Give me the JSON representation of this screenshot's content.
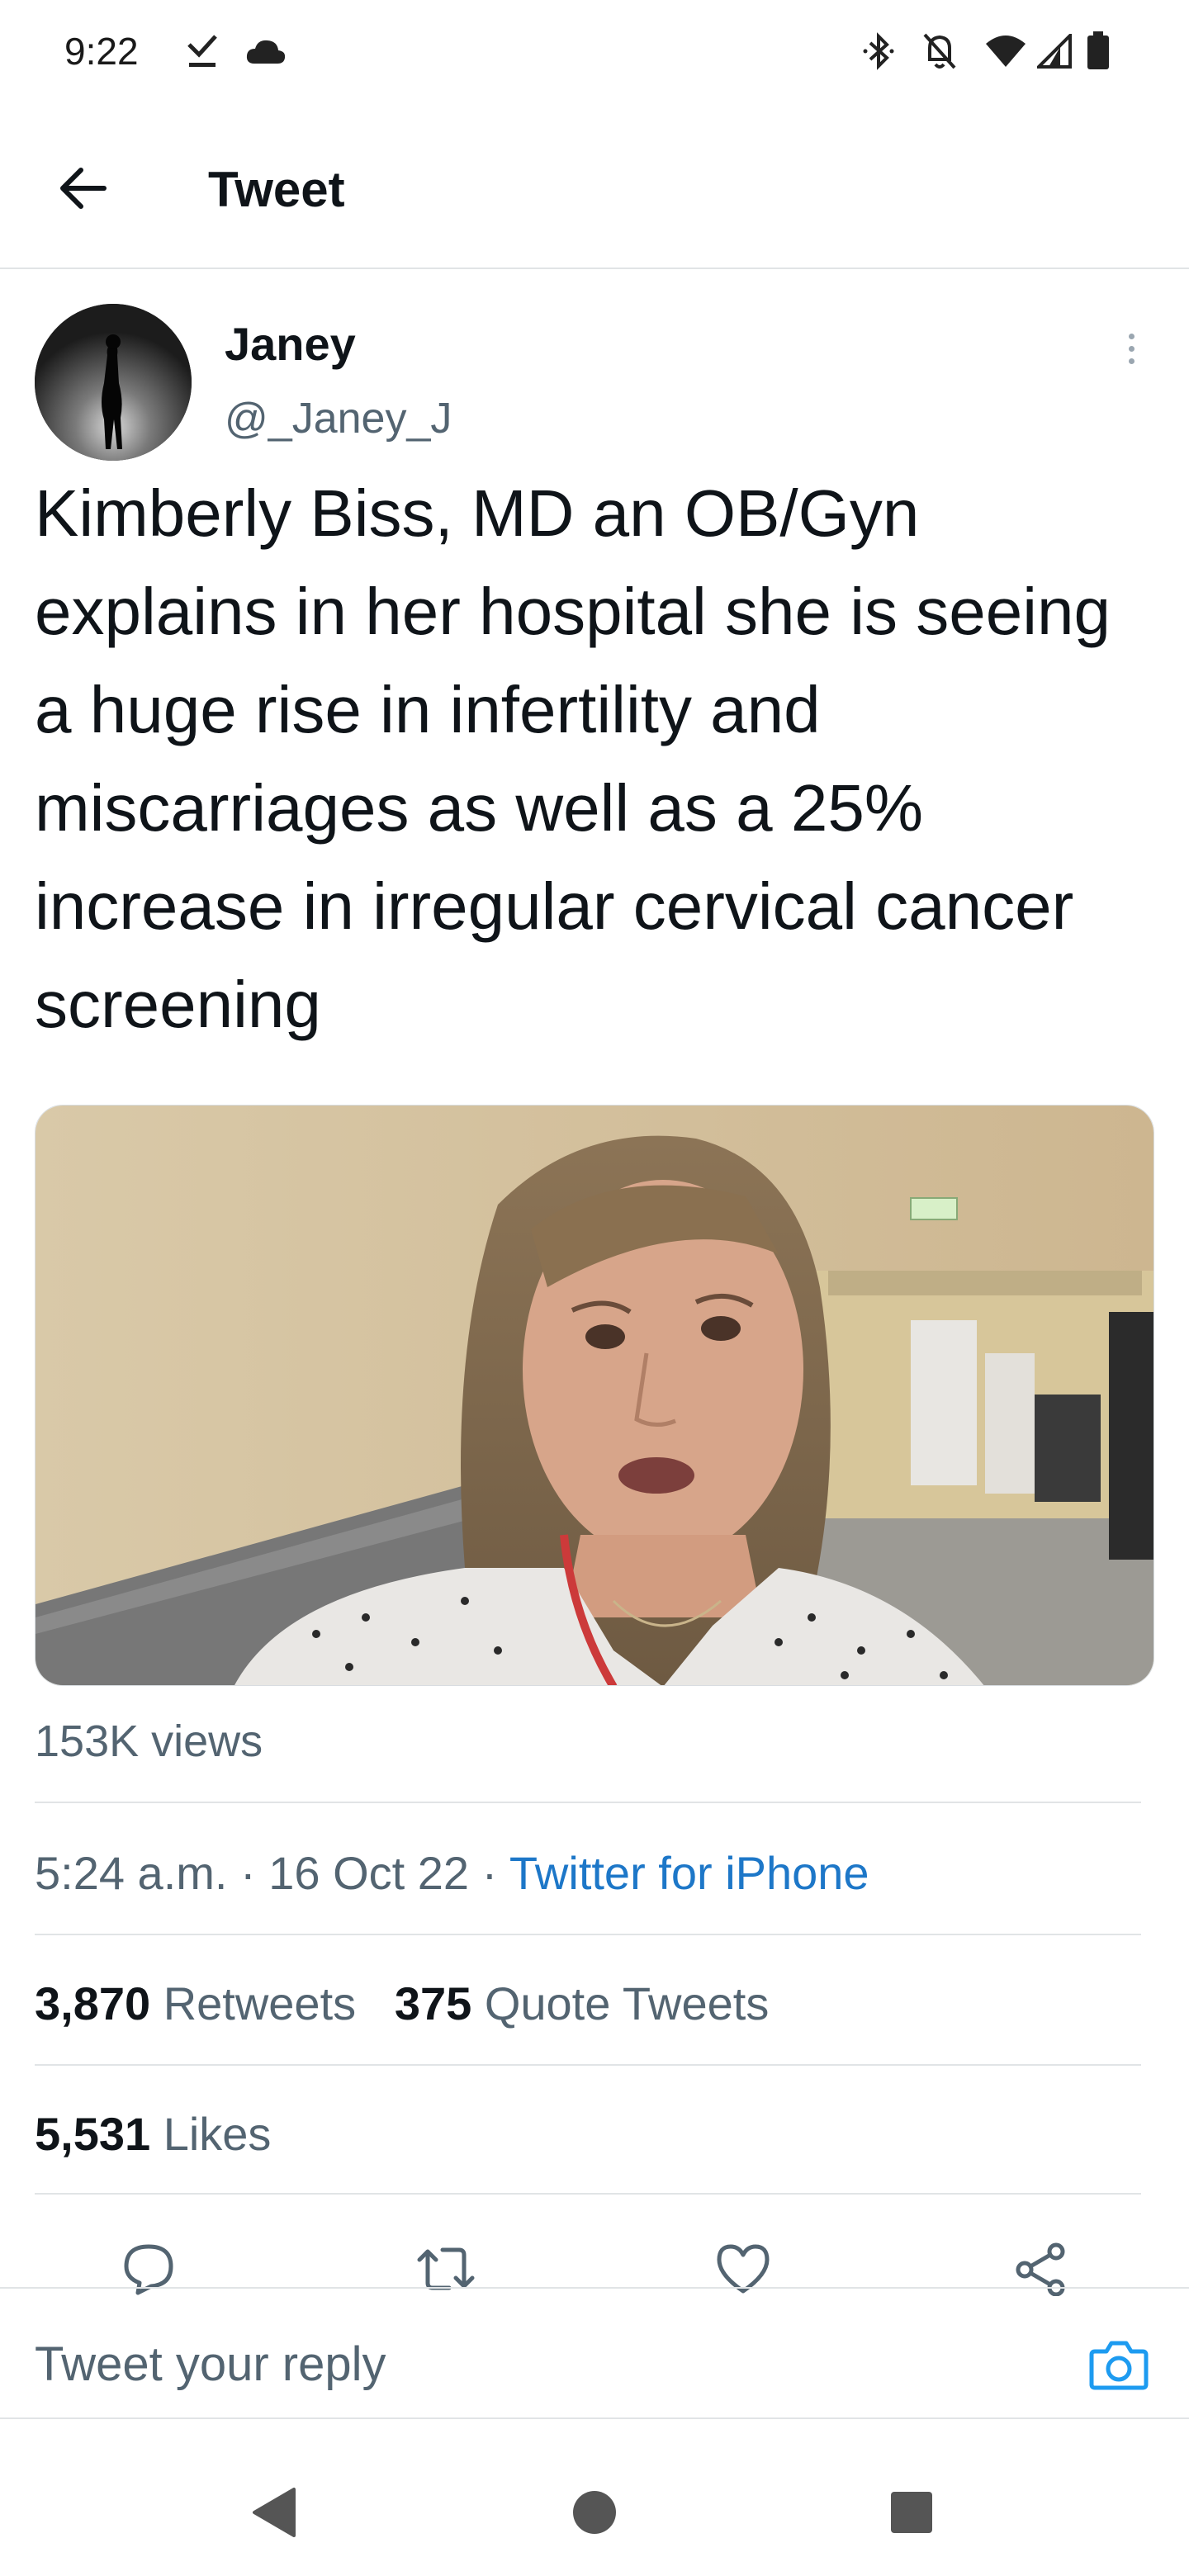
{
  "status_bar": {
    "time": "9:22",
    "left_icons": [
      "check-download-icon",
      "cloud-icon"
    ],
    "right_icons": [
      "bluetooth-icon",
      "bell-off-icon",
      "wifi-icon",
      "signal-icon",
      "battery-icon"
    ]
  },
  "header": {
    "back_icon": "arrow-left-icon",
    "title": "Tweet"
  },
  "tweet": {
    "author_name": "Janey",
    "author_handle": "@_Janey_J",
    "text": "Kimberly Biss, MD an OB/Gyn explains in her hospital she is seeing a huge rise in infertility and miscarriages as well as a 25% increase in irregular cervical cancer screening",
    "views": "153K views",
    "time": "5:24 a.m.",
    "sep1": " · ",
    "date": "16 Oct 22",
    "sep2": " · ",
    "source": "Twitter for iPhone",
    "retweets_count": "3,870",
    "retweets_label": "Retweets",
    "quotes_count": "375",
    "quotes_label": "Quote Tweets",
    "likes_count": "5,531",
    "likes_label": "Likes"
  },
  "actions": [
    "reply-icon",
    "retweet-icon",
    "like-icon",
    "share-icon"
  ],
  "reply_box": {
    "placeholder": "Tweet your reply",
    "camera_icon": "camera-icon"
  },
  "nav_bar": [
    "back-triangle-icon",
    "home-circle-icon",
    "recents-square-icon"
  ],
  "colors": {
    "accent": "#1d9bf0",
    "link": "#1d77c8",
    "text": "#0f1419",
    "muted": "#536471"
  }
}
